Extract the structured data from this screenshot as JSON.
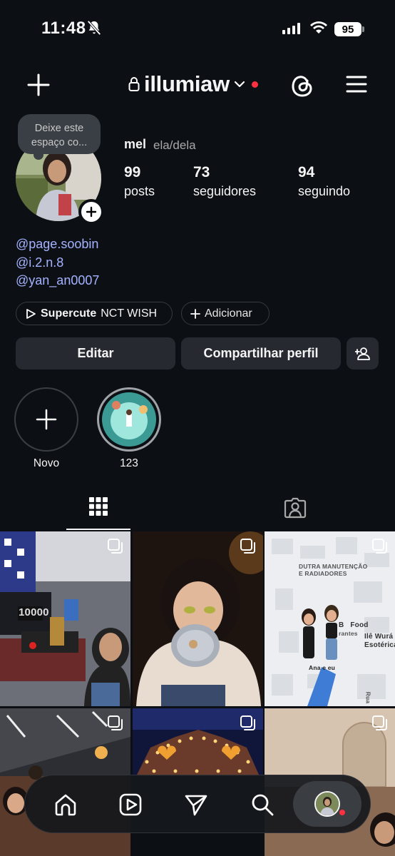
{
  "status": {
    "time": "11:48",
    "battery": "95"
  },
  "header": {
    "username": "illumiaw"
  },
  "note": {
    "text": "Deixe este espaço co..."
  },
  "profile": {
    "name": "mel",
    "pronouns": "ela/dela",
    "stats": [
      {
        "value": "99",
        "label": "posts"
      },
      {
        "value": "73",
        "label": "seguidores"
      },
      {
        "value": "94",
        "label": "seguindo"
      }
    ],
    "links": [
      "@page.soobin",
      "@i.2.n.8",
      "@yan_an0007"
    ]
  },
  "chips": {
    "music_bold": "Supercute",
    "music_artist": "NCT WISH",
    "add_label": "Adicionar"
  },
  "actions": {
    "edit": "Editar",
    "share": "Compartilhar perfil"
  },
  "highlights": [
    {
      "label": "Novo"
    },
    {
      "label": "123"
    }
  ],
  "grid_text": {
    "map_line1": "DUTRA MANUTENÇÃO",
    "map_line2": "E RADIADORES",
    "map_label": "Ana e eu",
    "map_place1": "Ilê Wurá",
    "map_place2": "Esotérica",
    "map_food": "B   Food",
    "map_rantes": "rantes",
    "map_rua": "Rua",
    "score": "10000"
  },
  "colors": {
    "background": "#0c1014",
    "link": "#a5b2ff",
    "notification": "#ff3040",
    "button": "#262a30"
  },
  "icons": [
    "bell-off-icon",
    "signal-icon",
    "wifi-icon",
    "plus-icon",
    "lock-icon",
    "chevron-down-icon",
    "threads-icon",
    "menu-icon",
    "play-icon",
    "add-person-icon",
    "grid-icon",
    "tagged-icon",
    "multi-post-icon",
    "home-icon",
    "reels-icon",
    "send-icon",
    "search-icon"
  ]
}
